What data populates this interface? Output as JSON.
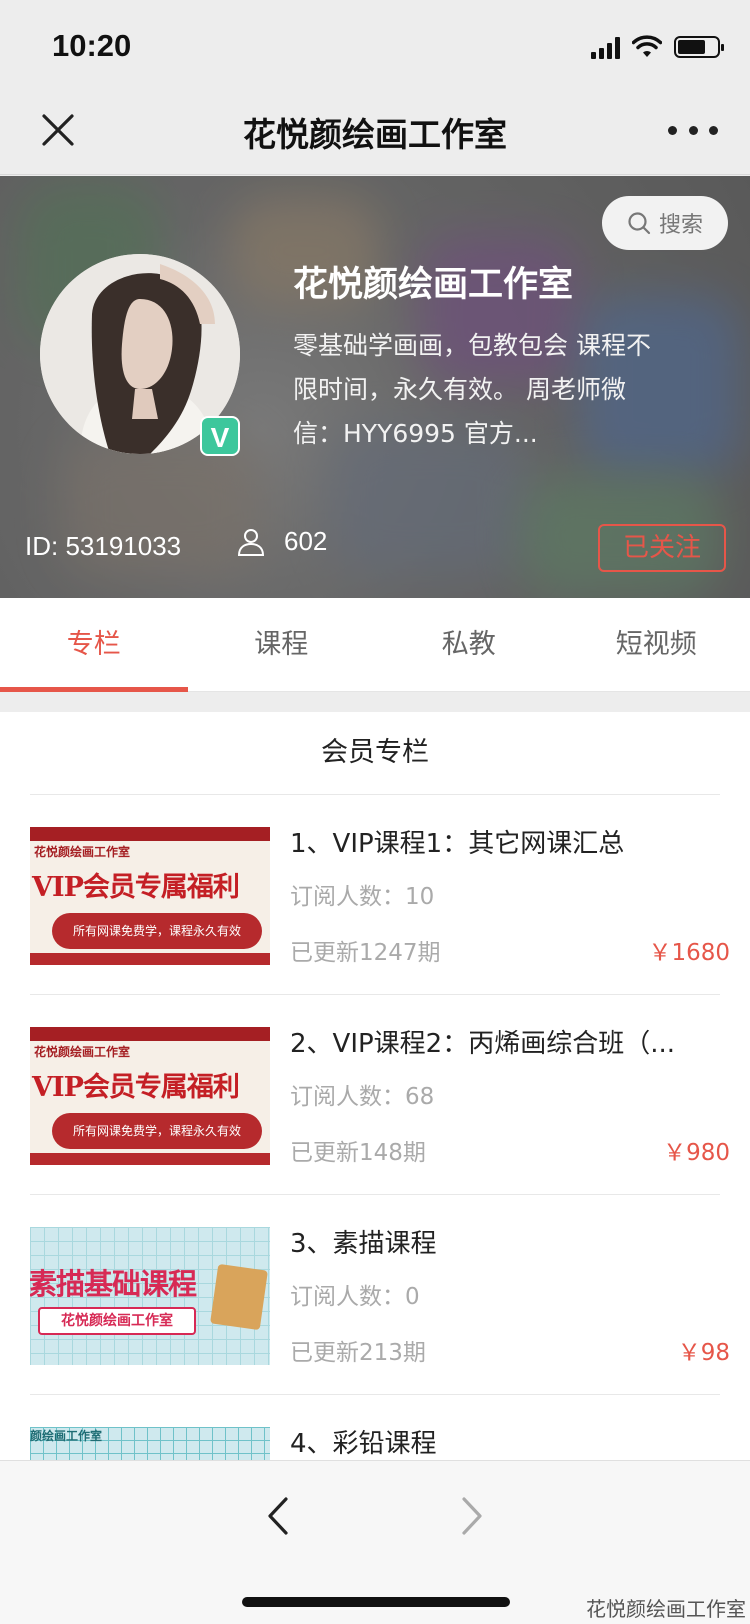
{
  "status_bar": {
    "time": "10:20"
  },
  "nav": {
    "title": "花悦颜绘画工作室"
  },
  "profile": {
    "search_label": "搜索",
    "name": "花悦颜绘画工作室",
    "description": "零基础学画画，包教包会 课程不限时间，永久有效。 周老师微信：HYY6995 官方...",
    "verified_badge": "V",
    "id_text": "ID: 53191033",
    "followers": "602",
    "follow_label": "已关注"
  },
  "tabs": [
    {
      "label": "专栏",
      "active": true
    },
    {
      "label": "课程",
      "active": false
    },
    {
      "label": "私教",
      "active": false
    },
    {
      "label": "短视频",
      "active": false
    }
  ],
  "section": {
    "title": "会员专栏",
    "courses": [
      {
        "title": "1、VIP课程1：其它网课汇总",
        "subscribers": "订阅人数：10",
        "updated": "已更新1247期",
        "price": "￥1680",
        "thumb": {
          "top": "花悦颜绘画工作室",
          "main": "VIP会员专属福利",
          "pill": "所有网课免费学，课程永久有效"
        }
      },
      {
        "title": "2、VIP课程2：丙烯画综合班（...",
        "subscribers": "订阅人数：68",
        "updated": "已更新148期",
        "price": "￥980",
        "thumb": {
          "top": "花悦颜绘画工作室",
          "main": "VIP会员专属福利",
          "pill": "所有网课免费学，课程永久有效"
        }
      },
      {
        "title": "3、素描课程",
        "subscribers": "订阅人数：0",
        "updated": "已更新213期",
        "price": "￥98",
        "thumb": {
          "main": "素描基础课程",
          "banner": "花悦颜绘画工作室"
        }
      },
      {
        "title": "4、彩铅课程",
        "thumb": {
          "top": "颜绘画工作室"
        }
      }
    ]
  },
  "footer": {
    "watermark": "花悦颜绘画工作室"
  },
  "colors": {
    "accent": "#e65649",
    "verified": "#3dc79c"
  }
}
